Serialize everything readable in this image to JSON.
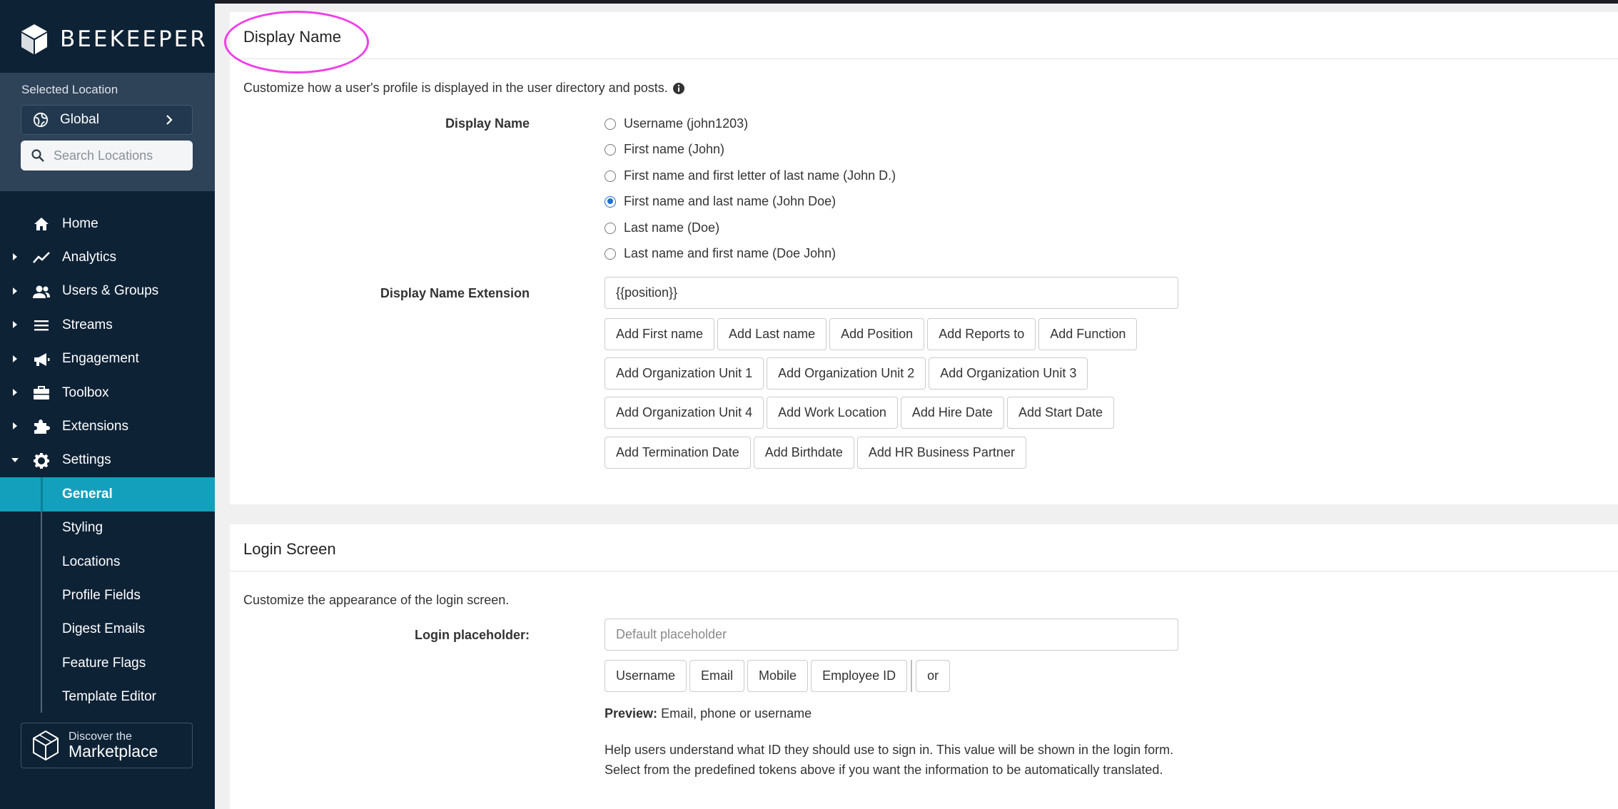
{
  "sidebar": {
    "brand": "BEEKEEPER",
    "location_label": "Selected Location",
    "location_value": "Global",
    "search_placeholder": "Search Locations",
    "nav": [
      {
        "label": "Home"
      },
      {
        "label": "Analytics"
      },
      {
        "label": "Users & Groups"
      },
      {
        "label": "Streams"
      },
      {
        "label": "Engagement"
      },
      {
        "label": "Toolbox"
      },
      {
        "label": "Extensions"
      },
      {
        "label": "Settings"
      }
    ],
    "settings_sub": [
      {
        "label": "General",
        "active": true
      },
      {
        "label": "Styling"
      },
      {
        "label": "Locations"
      },
      {
        "label": "Profile Fields"
      },
      {
        "label": "Digest Emails"
      },
      {
        "label": "Feature Flags"
      },
      {
        "label": "Template Editor"
      }
    ],
    "marketplace": {
      "line1": "Discover the",
      "line2": "Marketplace"
    }
  },
  "display_name": {
    "title": "Display Name",
    "description": "Customize how a user's profile is displayed in the user directory and posts.",
    "field_label": "Display Name",
    "options": [
      {
        "label": "Username (john1203)",
        "selected": false
      },
      {
        "label": "First name (John)",
        "selected": false
      },
      {
        "label": "First name and first letter of last name (John D.)",
        "selected": false
      },
      {
        "label": "First name and last name (John Doe)",
        "selected": true
      },
      {
        "label": "Last name (Doe)",
        "selected": false
      },
      {
        "label": "Last name and first name (Doe John)",
        "selected": false
      }
    ],
    "extension_label": "Display Name Extension",
    "extension_value": "{{position}}",
    "token_rows": [
      [
        "Add First name",
        "Add Last name",
        "Add Position",
        "Add Reports to",
        "Add Function"
      ],
      [
        "Add Organization Unit 1",
        "Add Organization Unit 2",
        "Add Organization Unit 3"
      ],
      [
        "Add Organization Unit 4",
        "Add Work Location",
        "Add Hire Date",
        "Add Start Date"
      ],
      [
        "Add Termination Date",
        "Add Birthdate",
        "Add HR Business Partner"
      ]
    ]
  },
  "login_screen": {
    "title": "Login Screen",
    "description": "Customize the appearance of the login screen.",
    "placeholder_label": "Login placeholder:",
    "placeholder_hint": "Default placeholder",
    "tokens": [
      "Username",
      "Email",
      "Mobile",
      "Employee ID"
    ],
    "separator_token": "or",
    "preview_label": "Preview:",
    "preview_value": "Email, phone or username",
    "help_line1": "Help users understand what ID they should use to sign in. This value will be shown in the login form.",
    "help_line2": "Select from the predefined tokens above if you want the information to be automatically translated."
  },
  "colors": {
    "sidebar_bg": "#0e2236",
    "location_panel_bg": "#2e4258",
    "active_item": "#12a0bd",
    "radio_selected": "#1f6fd6",
    "highlight_circle": "#f03ee8"
  }
}
